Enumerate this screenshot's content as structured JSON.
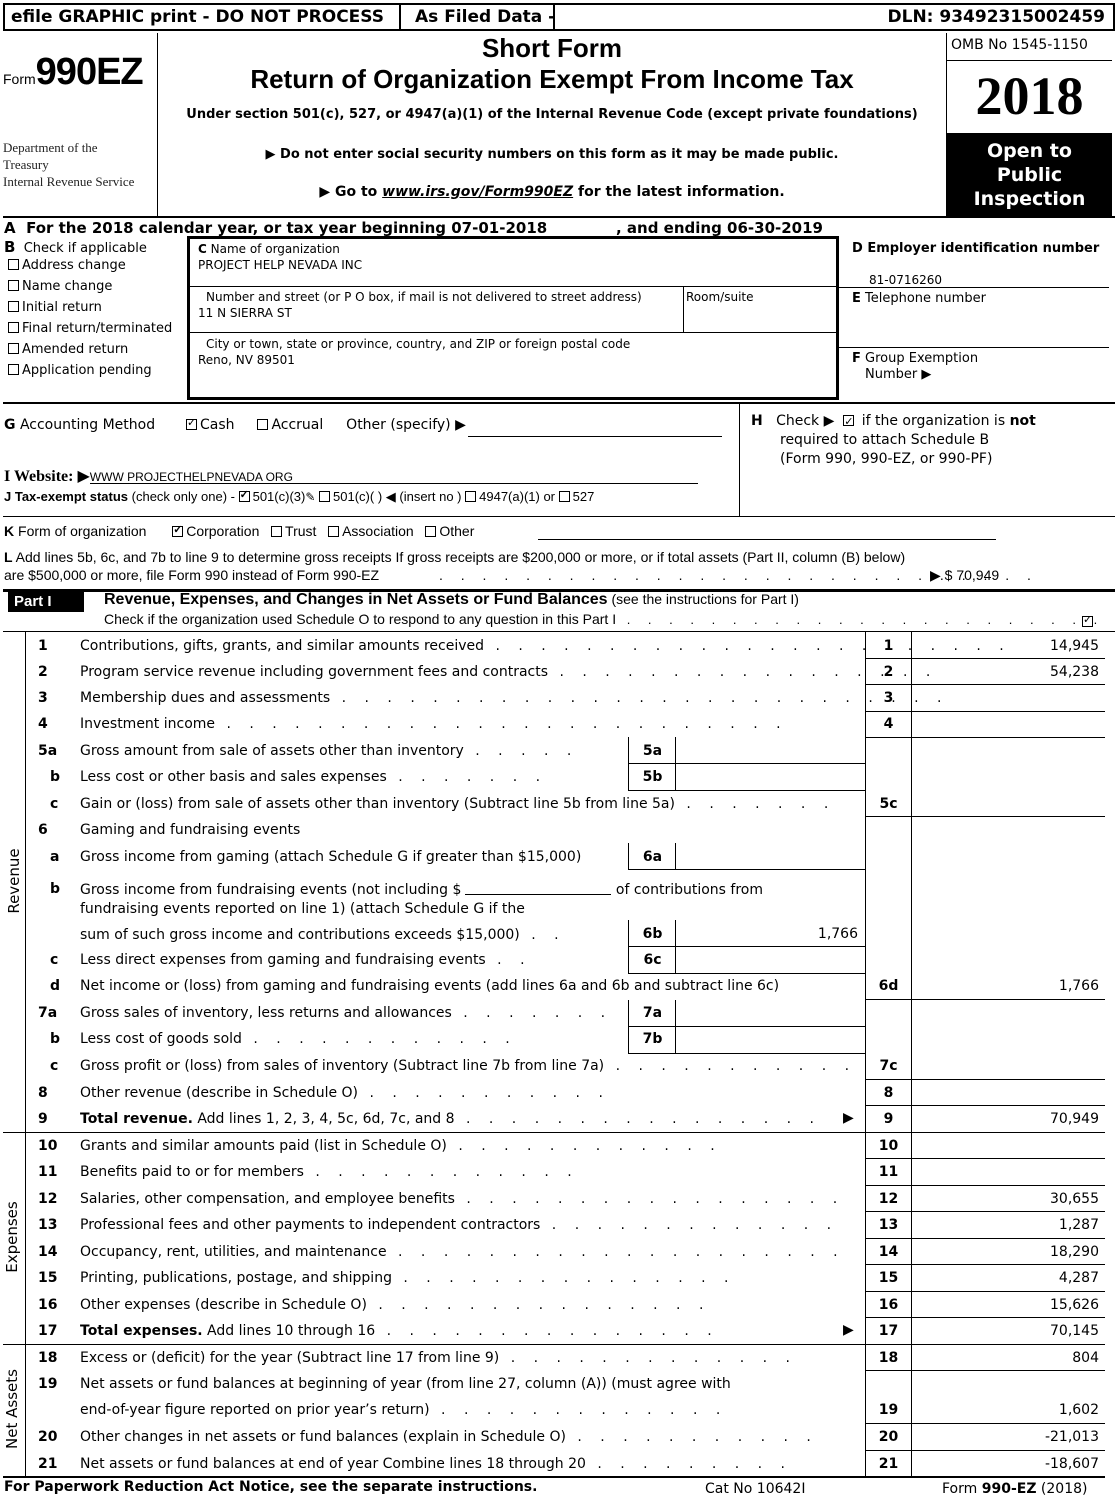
{
  "header": {
    "efile_banner": "efile GRAPHIC print - DO NOT PROCESS",
    "as_filed": "As Filed Data -",
    "dln": "DLN: 93492315002459",
    "form_prefix": "Form",
    "form_number": "990EZ",
    "dept_line1": "Department of the",
    "dept_line2": "Treasury",
    "dept_line3": "Internal Revenue Service",
    "title_line1": "Short Form",
    "title_line2": "Return of Organization Exempt From Income Tax",
    "subtitle": "Under section 501(c), 527, or 4947(a)(1) of the Internal Revenue Code (except private foundations)",
    "notice_ssn": "▶ Do not enter social security numbers on this form as it may be made public.",
    "goto_prefix": "▶  Go to ",
    "goto_link": "www.irs.gov/Form990EZ",
    "goto_suffix": " for the latest information.",
    "omb": "OMB No  1545-1150",
    "year": "2018",
    "open_line1": "Open to",
    "open_line2": "Public",
    "open_line3": "Inspection"
  },
  "section_a": {
    "label": "A",
    "text": "For the 2018 calendar year, or tax year beginning 07-01-2018",
    "ending": ", and ending 06-30-2019"
  },
  "section_b": {
    "label": "B",
    "heading": "Check if applicable",
    "options": [
      {
        "label": "Address change",
        "checked": false
      },
      {
        "label": "Name change",
        "checked": false
      },
      {
        "label": "Initial return",
        "checked": false
      },
      {
        "label": "Final return/terminated",
        "checked": false
      },
      {
        "label": "Amended return",
        "checked": false
      },
      {
        "label": "Application pending",
        "checked": false
      }
    ]
  },
  "section_c": {
    "name_label": "C",
    "name_caption": " Name of organization",
    "name_value": "PROJECT HELP NEVADA INC",
    "street_caption": "Number and street (or P  O  box, if mail is not delivered to street address)",
    "street_value": "11 N SIERRA ST",
    "room_caption": "Room/suite",
    "room_value": "",
    "city_caption": " City or town, state or province, country, and ZIP or foreign postal code",
    "city_value": "Reno, NV  89501"
  },
  "section_d": {
    "label": "D Employer identification number",
    "value": "81-0716260"
  },
  "section_e": {
    "label_letter": "E",
    "label": " Telephone number",
    "value": ""
  },
  "section_f": {
    "label_letter": "F",
    "label": " Group Exemption",
    "label2": "Number   ▶",
    "value": ""
  },
  "section_g": {
    "label_letter": "G",
    "label": " Accounting Method",
    "cash": "Cash",
    "cash_checked": true,
    "accrual": "Accrual",
    "accrual_checked": false,
    "other": "Other (specify) ▶",
    "other_value": ""
  },
  "section_h": {
    "label": "H",
    "text_pre": "Check ▶",
    "text_mid": " if the organization is ",
    "text_bold": "not",
    "line2": "required to attach Schedule B",
    "line3": "(Form 990, 990-EZ, or 990-PF)",
    "checked": true
  },
  "section_i": {
    "label": "I Website: ▶",
    "value": "WWW PROJECTHELPNEVADA ORG"
  },
  "section_j": {
    "label": "J Tax-exempt status",
    "hint": " (check only one) -",
    "opt1": "501(c)(3)",
    "opt1_checked": true,
    "opt2": "501(c)(  ) ◀ (insert no )",
    "opt3": "4947(a)(1) or",
    "opt4": "527"
  },
  "section_k": {
    "label_letter": "K",
    "label": " Form of organization",
    "opts": [
      {
        "label": "Corporation",
        "checked": true
      },
      {
        "label": "Trust",
        "checked": false
      },
      {
        "label": "Association",
        "checked": false
      },
      {
        "label": "Other",
        "checked": false
      }
    ]
  },
  "section_l": {
    "label_letter": "L",
    "line1": " Add lines 5b, 6c, and 7b to line 9 to determine gross receipts  If gross receipts are $200,000 or more, or if total assets (Part II, column (B) below)",
    "line2": "are $500,000 or more, file Form 990 instead of Form 990-EZ",
    "amount": "▶ $ 70,949"
  },
  "part1": {
    "badge": "Part I",
    "title": "Revenue, Expenses, and Changes in Net Assets or Fund Balances",
    "title_note": " (see the instructions for Part I)",
    "schedule_o_text": "Check if the organization used Schedule O to respond to any question in this Part I",
    "schedule_o_checked": true,
    "side_revenue": "Revenue",
    "side_expenses": "Expenses",
    "side_net_assets": "Net Assets",
    "lines": {
      "l1": {
        "num": "1",
        "desc": "Contributions, gifts, grants, and similar amounts received",
        "line": "1",
        "amount": "14,945"
      },
      "l2": {
        "num": "2",
        "desc": "Program service revenue including government fees and contracts",
        "line": "2",
        "amount": "54,238"
      },
      "l3": {
        "num": "3",
        "desc": "Membership dues and assessments",
        "line": "3",
        "amount": ""
      },
      "l4": {
        "num": "4",
        "desc": "Investment income",
        "line": "4",
        "amount": ""
      },
      "l5a": {
        "num": "5a",
        "desc": "Gross amount from sale of assets other than inventory",
        "line": "5a",
        "amount": ""
      },
      "l5b": {
        "num": "b",
        "desc": "Less  cost or other basis and sales expenses",
        "line": "5b",
        "amount": ""
      },
      "l5c": {
        "num": "c",
        "desc": "Gain or (loss) from sale of assets other than inventory (Subtract line 5b from line 5a)",
        "line": "5c",
        "amount": ""
      },
      "l6": {
        "num": "6",
        "desc": "Gaming and fundraising events"
      },
      "l6a": {
        "num": "a",
        "desc": "Gross income from gaming (attach Schedule G if greater than $15,000)",
        "line": "6a",
        "amount": ""
      },
      "l6b": {
        "num": "b",
        "desc": "Gross income from fundraising events (not including $",
        "desc_tail": " of contributions from",
        "desc2": "fundraising events reported on line 1) (attach Schedule G if the",
        "desc3": "sum of such gross income and contributions exceeds $15,000)",
        "line": "6b",
        "amount": "1,766",
        "blank_value": ""
      },
      "l6c": {
        "num": "c",
        "desc": "Less  direct expenses from gaming and fundraising events",
        "line": "6c",
        "amount": ""
      },
      "l6d": {
        "num": "d",
        "desc": "Net income or (loss) from gaming and fundraising events (add lines 6a and 6b and subtract line 6c)",
        "line": "6d",
        "amount": "1,766"
      },
      "l7a": {
        "num": "7a",
        "desc": "Gross sales of inventory, less returns and allowances",
        "line": "7a",
        "amount": ""
      },
      "l7b": {
        "num": "b",
        "desc": "Less  cost of goods sold",
        "line": "7b",
        "amount": ""
      },
      "l7c": {
        "num": "c",
        "desc": "Gross profit or (loss) from sales of inventory (Subtract line 7b from line 7a)",
        "line": "7c",
        "amount": ""
      },
      "l8": {
        "num": "8",
        "desc": "Other revenue (describe in Schedule O)",
        "line": "8",
        "amount": ""
      },
      "l9": {
        "num": "9",
        "desc_bold": "Total revenue.",
        "desc": " Add lines 1, 2, 3, 4, 5c, 6d, 7c, and 8",
        "line": "9",
        "amount": "70,949"
      },
      "l10": {
        "num": "10",
        "desc": "Grants and similar amounts paid (list in Schedule O)",
        "line": "10",
        "amount": ""
      },
      "l11": {
        "num": "11",
        "desc": "Benefits paid to or for members",
        "line": "11",
        "amount": ""
      },
      "l12": {
        "num": "12",
        "desc": "Salaries, other compensation, and employee benefits",
        "line": "12",
        "amount": "30,655"
      },
      "l13": {
        "num": "13",
        "desc": "Professional fees and other payments to independent contractors",
        "line": "13",
        "amount": "1,287"
      },
      "l14": {
        "num": "14",
        "desc": "Occupancy, rent, utilities, and maintenance",
        "line": "14",
        "amount": "18,290"
      },
      "l15": {
        "num": "15",
        "desc": "Printing, publications, postage, and shipping",
        "line": "15",
        "amount": "4,287"
      },
      "l16": {
        "num": "16",
        "desc": "Other expenses (describe in Schedule O)",
        "line": "16",
        "amount": "15,626"
      },
      "l17": {
        "num": "17",
        "desc_bold": "Total expenses.",
        "desc": " Add lines 10 through 16",
        "line": "17",
        "amount": "70,145"
      },
      "l18": {
        "num": "18",
        "desc": "Excess or (deficit) for the year (Subtract line 17 from line 9)",
        "line": "18",
        "amount": "804"
      },
      "l19": {
        "num": "19",
        "desc": "Net assets or fund balances at beginning of year (from line 27, column (A)) (must agree with",
        "desc2": "end-of-year figure reported on prior year’s return)",
        "line": "19",
        "amount": "1,602"
      },
      "l20": {
        "num": "20",
        "desc": "Other changes in net assets or fund balances (explain in Schedule O)",
        "line": "20",
        "amount": "-21,013"
      },
      "l21": {
        "num": "21",
        "desc": "Net assets or fund balances at end of year  Combine lines 18 through 20",
        "line": "21",
        "amount": "-18,607"
      }
    }
  },
  "footer": {
    "paperwork": "For Paperwork Reduction Act Notice, see the separate instructions.",
    "cat_no": "Cat  No  10642I",
    "form_prefix": "Form ",
    "form_bold": "990-EZ",
    "form_year": " (2018)"
  }
}
